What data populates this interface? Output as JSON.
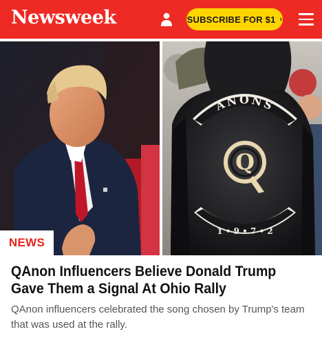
{
  "header": {
    "logo": "Newsweek",
    "subscribe_label": "SUBSCRIBE FOR $1",
    "subscribe_chevron": "›",
    "icons": [
      "user-icon",
      "menu-icon"
    ],
    "brand_color": "#ee2a24",
    "subscribe_color": "#ffd500"
  },
  "hero": {
    "left_image": "person-at-rally-photo",
    "right_image": "jacket-back-photo",
    "jacket_top_text": "ANONS",
    "jacket_center_letter": "Q",
    "jacket_bottom_text": "1 • 9 • 7 • 2"
  },
  "article": {
    "category": "NEWS",
    "category_color": "#e8231f",
    "headline": "QAnon Influencers Believe Donald Trump Gave Them a Signal At Ohio Rally",
    "summary": "QAnon influencers celebrated the song chosen by Trump's team that was used at the rally."
  }
}
